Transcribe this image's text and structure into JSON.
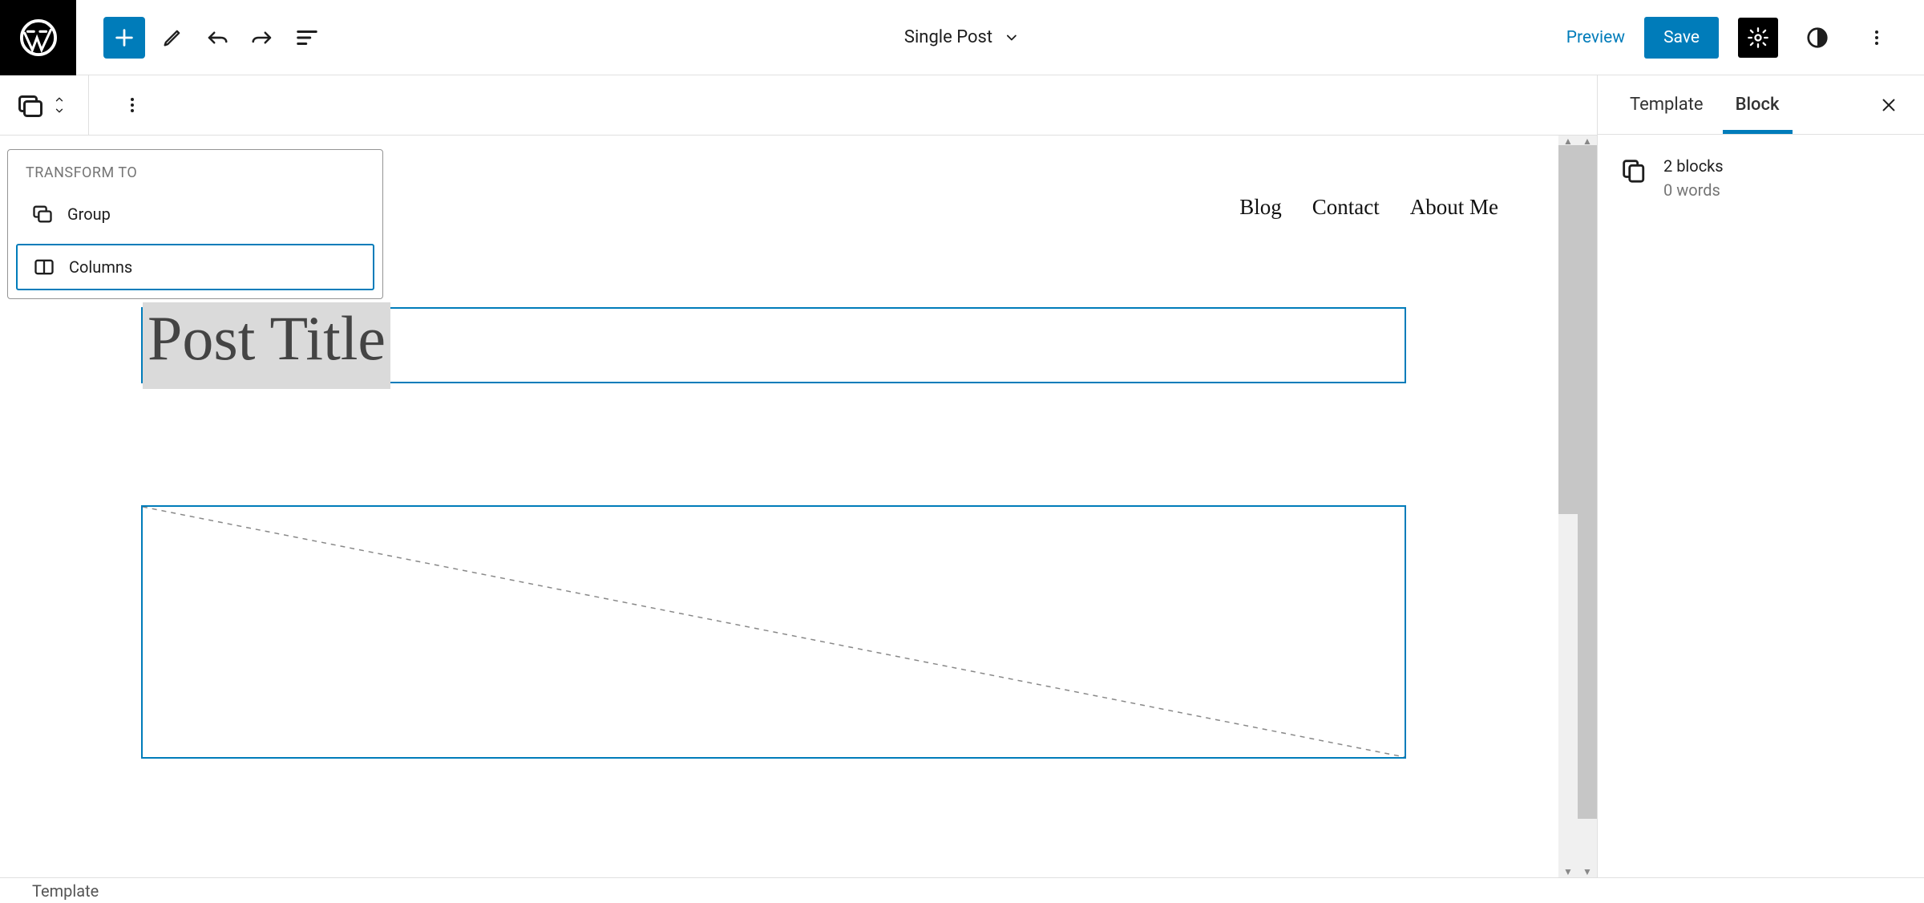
{
  "topbar": {
    "title": "Single Post",
    "preview_label": "Preview",
    "save_label": "Save"
  },
  "popover": {
    "header": "TRANSFORM TO",
    "items": [
      {
        "icon": "group",
        "label": "Group"
      },
      {
        "icon": "columns",
        "label": "Columns"
      }
    ],
    "selected_index": 1
  },
  "canvas": {
    "nav_items": [
      "Blog",
      "Contact",
      "About Me"
    ],
    "post_title_placeholder": "Post Title"
  },
  "sidebar": {
    "tabs": [
      "Template",
      "Block"
    ],
    "active_tab_index": 1,
    "summary_line1": "2 blocks",
    "summary_line2": "0 words"
  },
  "footer": {
    "breadcrumb": "Template"
  }
}
